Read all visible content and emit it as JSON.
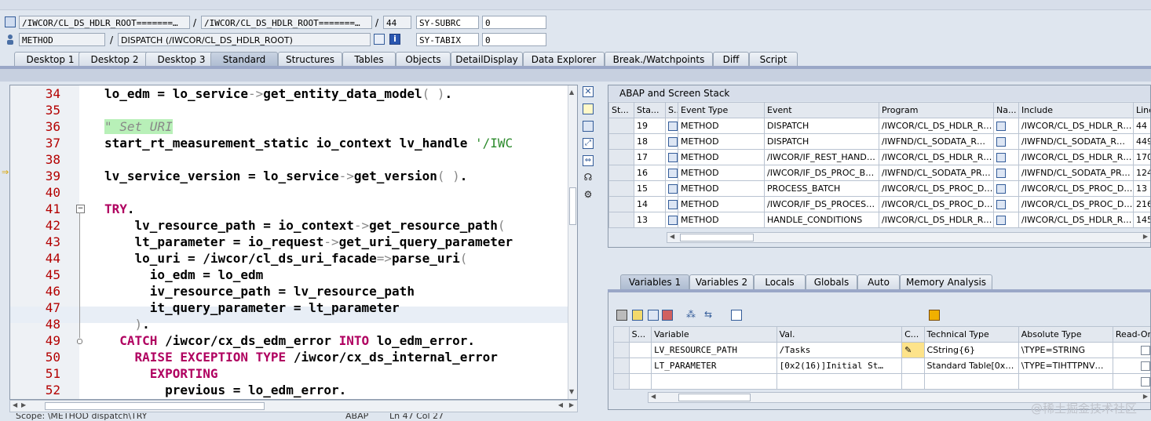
{
  "header": {
    "row1": {
      "field1": "/IWCOR/CL_DS_HDLR_ROOT=======…",
      "field2": "/IWCOR/CL_DS_HDLR_ROOT=======…",
      "line_no": "44",
      "var_name": "SY-SUBRC",
      "var_value": "0",
      "sep": "/"
    },
    "row2": {
      "event_type": "METHOD",
      "event": "DISPATCH (/IWCOR/CL_DS_HDLR_ROOT)",
      "var_name": "SY-TABIX",
      "var_value": "0",
      "sep": "/"
    }
  },
  "tabs": [
    {
      "label": "Desktop 1"
    },
    {
      "label": "Desktop 2"
    },
    {
      "label": "Desktop 3"
    },
    {
      "label": "Standard",
      "active": true
    },
    {
      "label": "Structures"
    },
    {
      "label": "Tables"
    },
    {
      "label": "Objects"
    },
    {
      "label": "DetailDisplay"
    },
    {
      "label": "Data Explorer"
    },
    {
      "label": "Break./Watchpoints"
    },
    {
      "label": "Diff"
    },
    {
      "label": "Script"
    }
  ],
  "editor": {
    "lines": [
      {
        "n": "34",
        "html": "lo_edm = lo_service<span class='op'>-></span>get_entity_data_model<span class='op'>( )</span>."
      },
      {
        "n": "35",
        "html": ""
      },
      {
        "n": "36",
        "html": "<span class='cmt'>\" Set URI</span>"
      },
      {
        "n": "37",
        "html": "start_rt_measurement_static io_context lv_handle <span class='str'>'/IWC</span>"
      },
      {
        "n": "38",
        "html": ""
      },
      {
        "n": "39",
        "html": "lv_service_version = lo_service<span class='op'>-></span>get_version<span class='op'>( )</span>."
      },
      {
        "n": "40",
        "html": ""
      },
      {
        "n": "41",
        "html": "<span class='kw'>TRY</span>."
      },
      {
        "n": "42",
        "html": "    lv_resource_path = io_context<span class='op'>-></span>get_resource_path<span class='op'>(</span>"
      },
      {
        "n": "43",
        "html": "    lt_parameter = io_request<span class='op'>-></span>get_uri_query_parameter"
      },
      {
        "n": "44",
        "html": "    lo_uri = /iwcor/cl_ds_uri_facade<span class='op'>=></span>parse_uri<span class='op'>(</span>"
      },
      {
        "n": "45",
        "html": "      io_edm = lo_edm"
      },
      {
        "n": "46",
        "html": "      iv_resource_path = lv_resource_path"
      },
      {
        "n": "47",
        "html": "      it_query_parameter = lt_parameter"
      },
      {
        "n": "48",
        "html": "    <span class='op'>)</span>."
      },
      {
        "n": "49",
        "html": "  <span class='kw'>CATCH</span> /iwcor/cx_ds_edm_error <span class='kw'>INTO</span> lo_edm_error."
      },
      {
        "n": "50",
        "html": "    <span class='kw'>RAISE EXCEPTION TYPE</span> /iwcor/cx_ds_internal_error"
      },
      {
        "n": "51",
        "html": "      <span class='kw'>EXPORTING</span>"
      },
      {
        "n": "52",
        "html": "        previous = lo_edm_error."
      }
    ],
    "status_left": "Scope: \\METHOD dispatch\\TRY",
    "status_mid": "ABAP",
    "status_pos": "Ln 47 Col 27"
  },
  "stack": {
    "title": "ABAP and Screen Stack",
    "columns": [
      "St...",
      "Sta...",
      "S...",
      "Event Type",
      "Event",
      "Program",
      "Na...",
      "Include",
      "Line"
    ],
    "rows": [
      {
        "current": true,
        "sta": "19",
        "type": "METHOD",
        "event": "DISPATCH",
        "program": "/IWCOR/CL_DS_HDLR_R…",
        "include": "/IWCOR/CL_DS_HDLR_R…",
        "line": "44"
      },
      {
        "current": false,
        "sta": "18",
        "type": "METHOD",
        "event": "DISPATCH",
        "program": "/IWFND/CL_SODATA_R…",
        "include": "/IWFND/CL_SODATA_R…",
        "line": "449"
      },
      {
        "current": false,
        "sta": "17",
        "type": "METHOD",
        "event": "/IWCOR/IF_REST_HAND…",
        "program": "/IWCOR/CL_DS_HDLR_R…",
        "include": "/IWCOR/CL_DS_HDLR_R…",
        "line": "170"
      },
      {
        "current": false,
        "sta": "16",
        "type": "METHOD",
        "event": "/IWCOR/IF_DS_PROC_B…",
        "program": "/IWFND/CL_SODATA_PR…",
        "include": "/IWFND/CL_SODATA_PR…",
        "line": "124"
      },
      {
        "current": false,
        "sta": "15",
        "type": "METHOD",
        "event": "PROCESS_BATCH",
        "program": "/IWCOR/CL_DS_PROC_D…",
        "include": "/IWCOR/CL_DS_PROC_D…",
        "line": "13"
      },
      {
        "current": false,
        "sta": "14",
        "type": "METHOD",
        "event": "/IWCOR/IF_DS_PROCES…",
        "program": "/IWCOR/CL_DS_PROC_D…",
        "include": "/IWCOR/CL_DS_PROC_D…",
        "line": "216"
      },
      {
        "current": false,
        "sta": "13",
        "type": "METHOD",
        "event": "HANDLE_CONDITIONS",
        "program": "/IWCOR/CL_DS_HDLR_R…",
        "include": "/IWCOR/CL_DS_HDLR_R…",
        "line": "145"
      }
    ]
  },
  "var_tabs": [
    {
      "label": "Variables 1",
      "active": true
    },
    {
      "label": "Variables 2"
    },
    {
      "label": "Locals"
    },
    {
      "label": "Globals"
    },
    {
      "label": "Auto"
    },
    {
      "label": "Memory Analysis"
    }
  ],
  "variables": {
    "columns": [
      "S...",
      "Variable",
      "Val.",
      "C...",
      "Technical Type",
      "Absolute Type",
      "Read-Only..."
    ],
    "rows": [
      {
        "name": "LV_RESOURCE_PATH",
        "value": "/Tasks",
        "tech": "CString{6}",
        "abs": "\\TYPE=STRING"
      },
      {
        "name": "LT_PARAMETER",
        "value": "[0x2(16)]Initial St…",
        "tech": "Standard Table[0x…",
        "abs": "\\TYPE=TIHTTPNV…"
      },
      {
        "name": "",
        "value": "",
        "tech": "",
        "abs": ""
      }
    ]
  },
  "watermark": "@稀土掘金技术社区",
  "colors": {
    "keyword": "#b00060",
    "line_number": "#b30000",
    "comment_bg": "#b8f0b8"
  }
}
